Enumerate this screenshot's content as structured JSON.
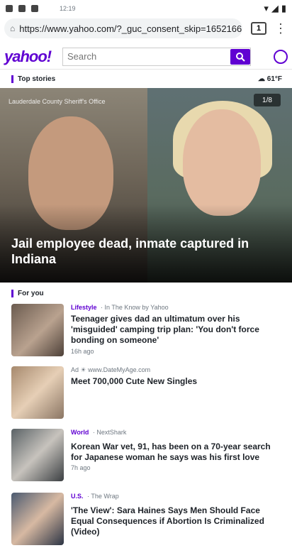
{
  "statusbar": {
    "time": "12:19"
  },
  "browser": {
    "url": "https://www.yahoo.com/?_guc_consent_skip=1652166",
    "tab_count": "1"
  },
  "header": {
    "logo": "yahoo!",
    "search_placeholder": "Search"
  },
  "top_stories": {
    "label": "Top stories",
    "weather": "61°F"
  },
  "hero": {
    "source": "Lauderdale County Sheriff's Office",
    "counter": "1/8",
    "headline": "Jail employee dead, inmate captured in Indiana"
  },
  "for_you": {
    "label": "For you"
  },
  "feed": [
    {
      "category": "Lifestyle",
      "source": "· In The Know by Yahoo",
      "title": "Teenager gives dad an ultimatum over his 'misguided' camping trip plan: 'You don't force bonding on someone'",
      "time": "16h ago"
    },
    {
      "category": "Ad",
      "source": "☀ www.DateMyAge.com",
      "title": "Meet 700,000 Cute New Singles",
      "time": ""
    },
    {
      "category": "World",
      "source": "· NextShark",
      "title": "Korean War vet, 91, has been on a 70-year search for Japanese woman he says was his first love",
      "time": "7h ago"
    },
    {
      "category": "U.S.",
      "source": "· The Wrap",
      "title": "'The View': Sara Haines Says Men Should Face Equal Consequences if Abortion Is Criminalized (Video)",
      "time": ""
    }
  ]
}
